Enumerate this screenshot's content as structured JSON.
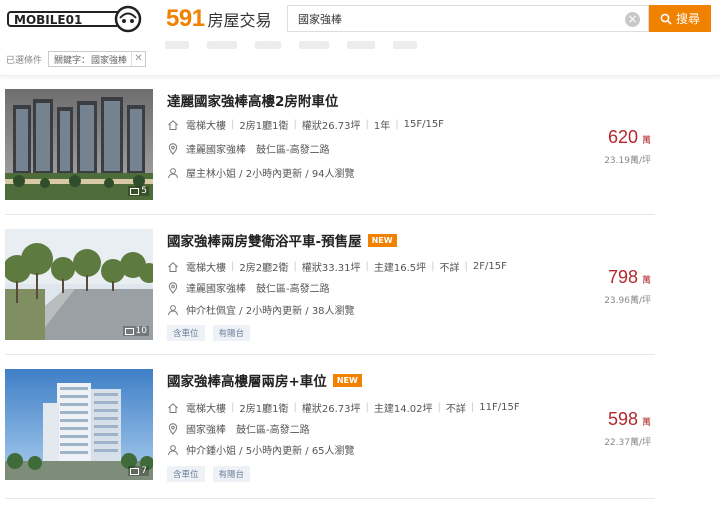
{
  "header": {
    "mobile01_logo_text": "MOBILE01",
    "brand_number": "591",
    "brand_text": "房屋交易",
    "search": {
      "value": "國家強棒",
      "clear_icon": "close-circle-icon"
    },
    "search_button_label": "搜尋",
    "search_button_icon": "search-icon",
    "accent_color": "#f08200"
  },
  "filters": {
    "label": "已選條件",
    "tags": [
      {
        "key": "關鍵字：",
        "value": "國家強棒"
      }
    ]
  },
  "listings": [
    {
      "title": "達麗國家強棒高樓2房附車位",
      "is_new": false,
      "new_label": "",
      "details": [
        "電梯大樓",
        "2房1廳1衛",
        "權狀26.73坪",
        "1年",
        "15F/15F"
      ],
      "address_name": "達麗國家強棒",
      "address_area": "鼓仁區-高發二路",
      "poster": "屋主林小姐 / 2小時內更新 / 94人瀏覽",
      "tags": [],
      "price": "620",
      "price_unit": "萬",
      "unit_price": "23.19萬/坪",
      "photo_count": "5"
    },
    {
      "title": "國家強棒兩房雙衛浴平車-預售屋",
      "is_new": true,
      "new_label": "NEW",
      "details": [
        "電梯大樓",
        "2房2廳2衛",
        "權狀33.31坪",
        "主建16.5坪",
        "不詳",
        "2F/15F"
      ],
      "address_name": "達麗國家強棒",
      "address_area": "鼓仁區-高發二路",
      "poster": "仲介杜佩宜 / 2小時內更新 / 38人瀏覽",
      "tags": [
        "含車位",
        "有陽台"
      ],
      "price": "798",
      "price_unit": "萬",
      "unit_price": "23.96萬/坪",
      "photo_count": "10"
    },
    {
      "title": "國家強棒高樓層兩房+車位",
      "is_new": true,
      "new_label": "NEW",
      "details": [
        "電梯大樓",
        "2房1廳1衛",
        "權狀26.73坪",
        "主建14.02坪",
        "不詳",
        "11F/15F"
      ],
      "address_name": "國家強棒",
      "address_area": "鼓仁區-高發二路",
      "poster": "仲介鍾小姐 / 5小時內更新 / 65人瀏覽",
      "tags": [
        "含車位",
        "有陽台"
      ],
      "price": "598",
      "price_unit": "萬",
      "unit_price": "22.37萬/坪",
      "photo_count": "7"
    }
  ],
  "icons": {
    "type": "home-icon",
    "address": "location-pin-icon",
    "poster": "user-icon",
    "photos": "image-icon"
  },
  "colors": {
    "price": "#b3282d",
    "new_badge": "#f08200",
    "tag_text": "#6a7d99"
  }
}
